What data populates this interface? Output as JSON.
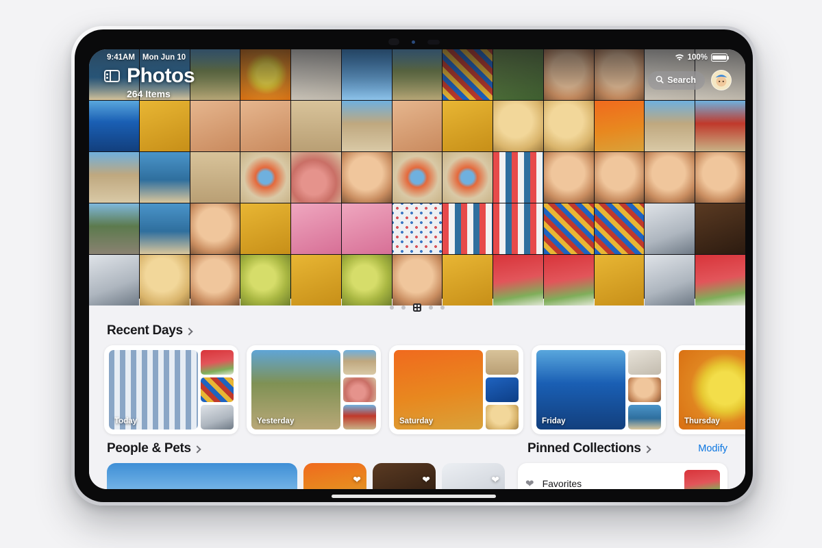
{
  "device": {
    "name": "iPad",
    "status_bar": {
      "time": "9:41AM",
      "date": "Mon Jun 10",
      "wifi_icon": "wifi-icon",
      "battery_percent": "100%",
      "battery_icon": "battery-full-icon"
    }
  },
  "app": {
    "sidebar_toggle_icon": "sidebar-toggle-icon",
    "title": "Photos",
    "subtitle": "264 Items",
    "search": {
      "label": "Search",
      "icon": "search-icon"
    },
    "avatar_icon": "user-avatar"
  },
  "page_dots": {
    "count": 5,
    "active_index": 2,
    "active_icon": "grid-view-icon"
  },
  "sections": {
    "recent_days": {
      "title": "Recent Days",
      "chevron_icon": "chevron-right-icon",
      "cards": [
        {
          "label": "Today",
          "main_class": "p-wmbed",
          "thumbs": [
            "p-wmelon",
            "p-quilt",
            "p-room"
          ]
        },
        {
          "label": "Yesterday",
          "main_class": "p-dune",
          "thumbs": [
            "p-beach",
            "p-shell",
            "p-hut"
          ]
        },
        {
          "label": "Saturday",
          "main_class": "p-orange",
          "thumbs": [
            "p-sand",
            "p-blue",
            "p-blond"
          ]
        },
        {
          "label": "Friday",
          "main_class": "p-bluehs",
          "thumbs": [
            "p-wall",
            "p-face",
            "p-sea"
          ]
        },
        {
          "label": "Thursday",
          "main_class": "p-lemon",
          "thumbs": [
            "p-grass",
            "p-yellow",
            "p-sand"
          ]
        }
      ]
    },
    "people_and_pets": {
      "title": "People & Pets",
      "chevron_icon": "chevron-right-icon",
      "tiles": [
        {
          "size": "wide",
          "class": "p-sky",
          "heart": false
        },
        {
          "size": "sq",
          "class": "p-orange",
          "heart": true,
          "heart_icon": "heart-icon"
        },
        {
          "size": "sq",
          "class": "p-hair",
          "heart": true,
          "heart_icon": "heart-icon"
        },
        {
          "size": "sq",
          "class": "p-white",
          "heart": true,
          "heart_icon": "heart-icon"
        }
      ]
    },
    "pinned_collections": {
      "title": "Pinned Collections",
      "chevron_icon": "chevron-right-icon",
      "modify_label": "Modify",
      "items": [
        {
          "label": "Favorites",
          "icon": "heart-filled-icon",
          "thumb_class": "p-wmelon"
        }
      ]
    }
  },
  "photo_grid": {
    "columns": 13,
    "rows": 5,
    "cells": [
      "p-sea",
      "p-sea",
      "p-dune",
      "p-lemon",
      "p-wall",
      "p-sky",
      "p-dune",
      "p-quilt",
      "p-grass",
      "p-face",
      "p-face",
      "p-wall",
      "p-wall",
      "p-bluehs",
      "p-yellow",
      "p-skin",
      "p-skin",
      "p-sand",
      "p-beach",
      "p-skin",
      "p-yellow",
      "p-blond",
      "p-blond",
      "p-orange",
      "p-beach",
      "p-hut",
      "p-beach",
      "p-sea",
      "p-sand",
      "p-float",
      "p-shell",
      "p-face",
      "p-float",
      "p-float",
      "p-stripe",
      "p-face",
      "p-face",
      "p-face",
      "p-face",
      "p-cliff",
      "p-sea",
      "p-face",
      "p-yellow",
      "p-pink",
      "p-pink",
      "p-dot",
      "p-stripe",
      "p-stripe",
      "p-quilt",
      "p-quilt",
      "p-room",
      "p-hair",
      "p-room",
      "p-blond",
      "p-face",
      "p-grapes",
      "p-yellow",
      "p-grapes",
      "p-face",
      "p-yellow",
      "p-wmelon",
      "p-wmelon",
      "p-yellow",
      "p-room",
      "p-wmelon"
    ]
  },
  "home_indicator": "home-indicator"
}
